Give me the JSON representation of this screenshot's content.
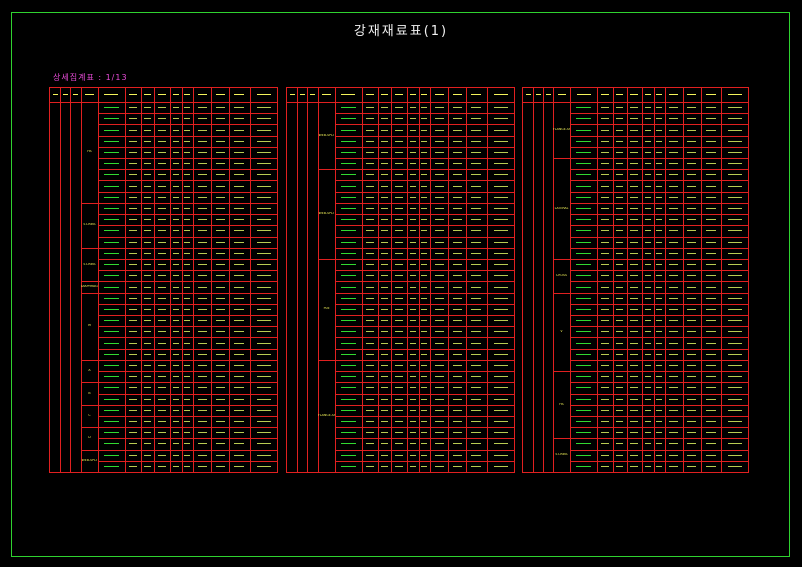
{
  "title": "강재재료표(1)",
  "subtitle": "상세집계표 : 1/13",
  "colors": {
    "frame": "#2fd22f",
    "grid": "#e02020",
    "text_green": "#39ff39",
    "text_yellow": "#f4f45a",
    "subtitle": "#e84cd8"
  },
  "tables": [
    {
      "rows": 33,
      "groups": [
        {
          "label": "HS",
          "span": 9
        },
        {
          "label": "ST-RIBS",
          "span": 4
        },
        {
          "label": "ST-RIBS",
          "span": 3
        },
        {
          "label": "DIAPHRAGM",
          "span": 1
        },
        {
          "label": "M",
          "span": 6
        },
        {
          "label": "A",
          "span": 2
        },
        {
          "label": "B",
          "span": 2
        },
        {
          "label": "C",
          "span": 2
        },
        {
          "label": "D",
          "span": 2
        },
        {
          "label": "WEB-SPLT",
          "span": 2
        }
      ]
    },
    {
      "rows": 33,
      "groups": [
        {
          "label": "WEB-SPLT",
          "span": 6
        },
        {
          "label": "WEB-SPLT",
          "span": 8
        },
        {
          "label": "PL6",
          "span": 9
        },
        {
          "label": "FLANGE-SPLT",
          "span": 10
        }
      ]
    },
    {
      "rows": 33,
      "groups": [
        {
          "label": "FLANGE-SPLT",
          "span": 5
        },
        {
          "label": "LATERAL",
          "span": 9
        },
        {
          "label": "CROSS",
          "span": 3
        },
        {
          "label": "V",
          "span": 7
        },
        {
          "label": "HS",
          "span": 6
        },
        {
          "label": "ST-RIBS",
          "span": 3
        }
      ]
    }
  ]
}
